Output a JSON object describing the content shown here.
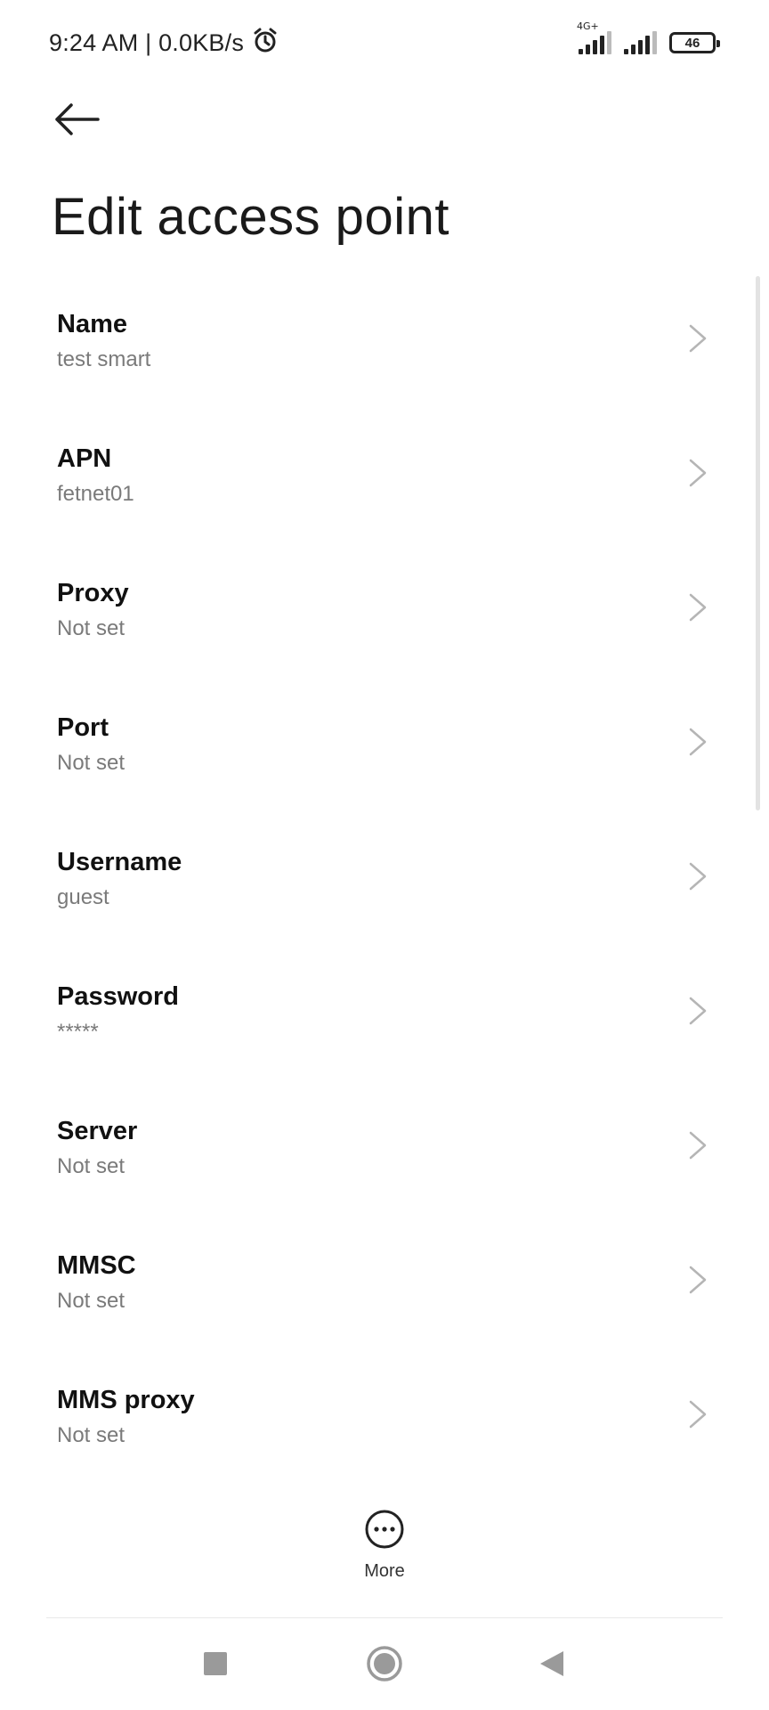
{
  "status_bar": {
    "time_text": "9:24 AM | 0.0KB/s",
    "network_type": "4G+",
    "battery_level": "46",
    "icons": [
      "alarm-icon",
      "signal-4g-icon",
      "signal-icon",
      "battery-icon"
    ]
  },
  "header": {
    "back_icon": "arrow-left-icon",
    "title": "Edit access point"
  },
  "items": [
    {
      "label": "Name",
      "value": "test smart"
    },
    {
      "label": "APN",
      "value": "fetnet01"
    },
    {
      "label": "Proxy",
      "value": "Not set"
    },
    {
      "label": "Port",
      "value": "Not set"
    },
    {
      "label": "Username",
      "value": "guest"
    },
    {
      "label": "Password",
      "value": "*****"
    },
    {
      "label": "Server",
      "value": "Not set"
    },
    {
      "label": "MMSC",
      "value": "Not set"
    },
    {
      "label": "MMS proxy",
      "value": "Not set"
    }
  ],
  "footer": {
    "more_label": "More",
    "more_icon": "more-dots-icon"
  },
  "nav_bar": {
    "icons": [
      "recent-apps-icon",
      "home-icon",
      "back-triangle-icon"
    ]
  },
  "colors": {
    "background": "#ffffff",
    "primary_text": "#111111",
    "secondary_text": "#7a7a7a",
    "chevron": "#b5b5b5"
  }
}
